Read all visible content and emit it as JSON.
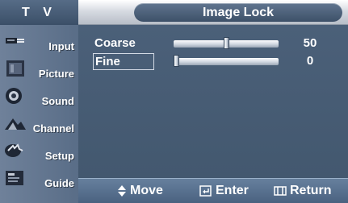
{
  "header": {
    "menu_title": "T V",
    "page_title": "Image Lock"
  },
  "sidebar": {
    "items": [
      {
        "label": "Input",
        "icon": "input-cable-icon"
      },
      {
        "label": "Picture",
        "icon": "picture-icon"
      },
      {
        "label": "Sound",
        "icon": "speaker-icon"
      },
      {
        "label": "Channel",
        "icon": "channel-icon"
      },
      {
        "label": "Setup",
        "icon": "setup-icon"
      },
      {
        "label": "Guide",
        "icon": "guide-icon"
      }
    ]
  },
  "settings": [
    {
      "label": "Coarse",
      "value": "50",
      "level": 0.5,
      "selected": false
    },
    {
      "label": "Fine",
      "value": "0",
      "level": 0.0,
      "selected": true
    }
  ],
  "footer": {
    "move_label": "Move",
    "enter_label": "Enter",
    "return_label": "Return"
  },
  "colors": {
    "accent": "#4b6079",
    "bar": "#cfd6e0"
  }
}
